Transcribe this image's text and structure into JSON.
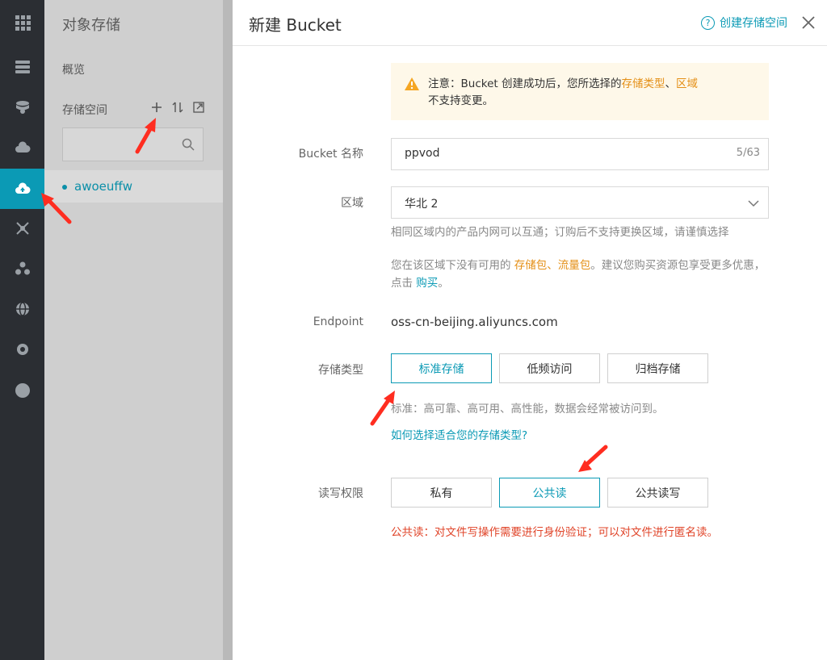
{
  "sidebar": {
    "title": "对象存储",
    "overview": "概览",
    "storage_label": "存储空间",
    "search_placeholder": "",
    "bucket_name": "awoeuffw"
  },
  "panel": {
    "title": "新建 Bucket",
    "help_link": "创建存储空间",
    "notice": {
      "prefix": "注意：Bucket 创建成功后，您所选择的",
      "type_word": "存储类型",
      "sep": "、",
      "region_word": "区域",
      "suffix": "不支持变更。"
    },
    "bucket_name": {
      "label": "Bucket 名称",
      "value": "ppvod",
      "counter": "5/63"
    },
    "region": {
      "label": "区域",
      "value": "华北 2",
      "hint": "相同区域内的产品内网可以互通；订购后不支持更换区域，请谨慎选择",
      "pkg_prefix": "您在该区域下没有可用的 ",
      "pkg_storage": "存储包",
      "pkg_sep": "、",
      "pkg_traffic": "流量包",
      "pkg_mid": "。建议您购买资源包享受更多优惠，点击 ",
      "pkg_buy": "购买",
      "pkg_end": "。"
    },
    "endpoint": {
      "label": "Endpoint",
      "value": "oss-cn-beijing.aliyuncs.com"
    },
    "storage_type": {
      "label": "存储类型",
      "options": [
        "标准存储",
        "低频访问",
        "归档存储"
      ],
      "selected": "标准存储",
      "desc": "标准：高可靠、高可用、高性能，数据会经常被访问到。",
      "help_link": "如何选择适合您的存储类型?"
    },
    "acl": {
      "label": "读写权限",
      "options": [
        "私有",
        "公共读",
        "公共读写"
      ],
      "selected": "公共读",
      "warning": "公共读：对文件写操作需要进行身份验证；可以对文件进行匿名读。"
    }
  },
  "colors": {
    "accent": "#0b9ab5",
    "warning": "#e48f16",
    "danger": "#e0452a",
    "annotation_arrow": "#ff2d20"
  }
}
